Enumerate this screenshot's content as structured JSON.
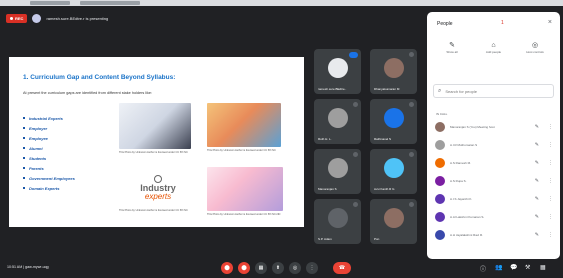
{
  "top_bar": {
    "rec_label": "REC",
    "presenting_text": "ramesh.sure.BEdtre.r is presenting"
  },
  "slide": {
    "title": "1. Curriculum Gap and Content Beyond Syllabus:",
    "subtitle": "At present the curriculum gaps are identified from different stake holders like:",
    "stakeholders": [
      "Industrial Experts",
      "Employer",
      "Employee",
      "Alumni",
      "Students",
      "Parents",
      "Government Employees",
      "Domain Experts"
    ],
    "logo_line1": "Industry",
    "logo_line2": "experts",
    "captions": [
      "This Photo by Unknown Author is licensed under CC BY-NC",
      "This Photo by Unknown Author is licensed under CC BY-NC",
      "This Photo by Unknown Author is licensed under CC BY-NC",
      "This Photo by Unknown Author is licensed under CC BY-NC-ND"
    ]
  },
  "tiles": [
    {
      "name": "ramesh.sure.BEdtre..",
      "avatar_color": "#e8eaed"
    },
    {
      "name": "Dhanyakumaran M",
      "avatar_color": "#8d6e63"
    },
    {
      "name": "Ruth H. L.",
      "avatar_color": "#9e9e9e"
    },
    {
      "name": "Rathinavel S",
      "avatar_color": "#1a73e8"
    },
    {
      "name": "Manoranjan S",
      "avatar_color": "#9e9e9e"
    },
    {
      "name": "Avvi Kanth R G",
      "avatar_color": "#4fc3f7"
    },
    {
      "name": "S.P. Adam",
      "avatar_color": "#5f6368"
    },
    {
      "name": "Pon",
      "avatar_color": "#8d6e63"
    }
  ],
  "people_panel": {
    "title": "People",
    "close": "×",
    "extra_label": "1",
    "actions": [
      {
        "icon": "✎",
        "label": "Show all"
      },
      {
        "icon": "⌂",
        "label": "Add people"
      },
      {
        "icon": "◎",
        "label": "Host controls"
      }
    ],
    "search_placeholder": "Search for people",
    "in_call_label": "IN CALL",
    "participants": [
      {
        "name": "Manoranjan S (You) Meeting host",
        "avatar_color": "#8d6e63"
      },
      {
        "name": "A.I.R Muthumaran S",
        "avatar_color": "#9e9e9e"
      },
      {
        "name": "A.S Ramesh M.",
        "avatar_color": "#ef6c00"
      },
      {
        "name": "A.S Rupa S.",
        "avatar_color": "#7b1fa2"
      },
      {
        "name": "A.I.S Jayanthi K.",
        "avatar_color": "#5e35b1"
      },
      {
        "name": "A.Al Lakshmi Kumaran S.",
        "avatar_color": "#5e35b1"
      },
      {
        "name": "A.H Jayalakshmi Ravi R.",
        "avatar_color": "#3949ab"
      }
    ]
  },
  "bottom_bar": {
    "time_code": "10:51 AM  |  gaw-mywr-uqg",
    "controls": [
      "⬤",
      "⬤",
      "▦",
      "⬆",
      "◎",
      "⋮",
      "☎"
    ],
    "right_icons": [
      "ⓘ",
      "👥",
      "💬",
      "⚒",
      "▦"
    ]
  }
}
